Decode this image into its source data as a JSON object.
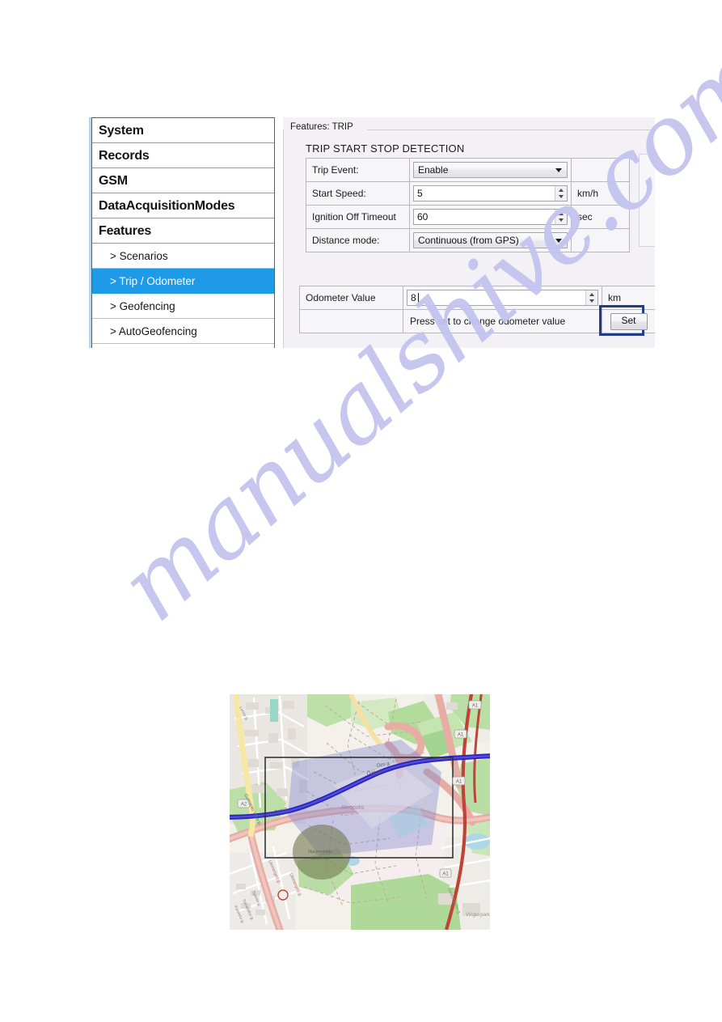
{
  "window": {
    "groupbox_caption": "Features: TRIP",
    "section_title": "TRIP START STOP DETECTION"
  },
  "sidebar": {
    "items": [
      {
        "label": "System",
        "type": "group",
        "selected": false
      },
      {
        "label": "Records",
        "type": "group",
        "selected": false
      },
      {
        "label": "GSM",
        "type": "group",
        "selected": false
      },
      {
        "label": "DataAcquisitionModes",
        "type": "group",
        "selected": false
      },
      {
        "label": "Features",
        "type": "group",
        "selected": false
      },
      {
        "label": "> Scenarios",
        "type": "child",
        "selected": false
      },
      {
        "label": "> Trip / Odometer",
        "type": "child",
        "selected": true
      },
      {
        "label": "> Geofencing",
        "type": "child",
        "selected": false
      },
      {
        "label": "> AutoGeofencing",
        "type": "child",
        "selected": false
      }
    ],
    "selected_color": "#1e9ae6"
  },
  "trip_form": {
    "rows": [
      {
        "label": "Trip Event:",
        "control": "combo",
        "value": "Enable",
        "unit": ""
      },
      {
        "label": "Start Speed:",
        "control": "spin",
        "value": "5",
        "unit": "km/h"
      },
      {
        "label": "Ignition Off Timeout",
        "control": "spin",
        "value": "60",
        "unit": "sec"
      },
      {
        "label": "Distance mode:",
        "control": "combo",
        "value": "Continuous (from GPS)",
        "unit": ""
      }
    ]
  },
  "odometer": {
    "label": "Odometer Value",
    "value": "8",
    "unit": "km",
    "hint": "Press set to change odometer value",
    "set_button": "Set",
    "highlight_color": "#1f3d8c"
  },
  "watermark": {
    "text": "manualshive.com",
    "color": "#c3c4ef"
  },
  "map": {
    "road_labels": [
      "A2",
      "A1",
      "A1",
      "A1"
    ],
    "street_labels": [
      "Ozo g.",
      "Ozo g.",
      "Ukmerges g.",
      "Ukmerges g.",
      "Gelezinio Vilko g.",
      "Sporto g.",
      "Sanaudos g.",
      "Kareiviu g."
    ],
    "area_labels": [
      "Vingio parkas",
      "Akropolis",
      "Nacionalinis stadionas"
    ],
    "overlay": {
      "geofence_rect_color": "#2a2a2a",
      "track_color": "#2119c6",
      "zone_fill": "#7a7fd0"
    }
  }
}
